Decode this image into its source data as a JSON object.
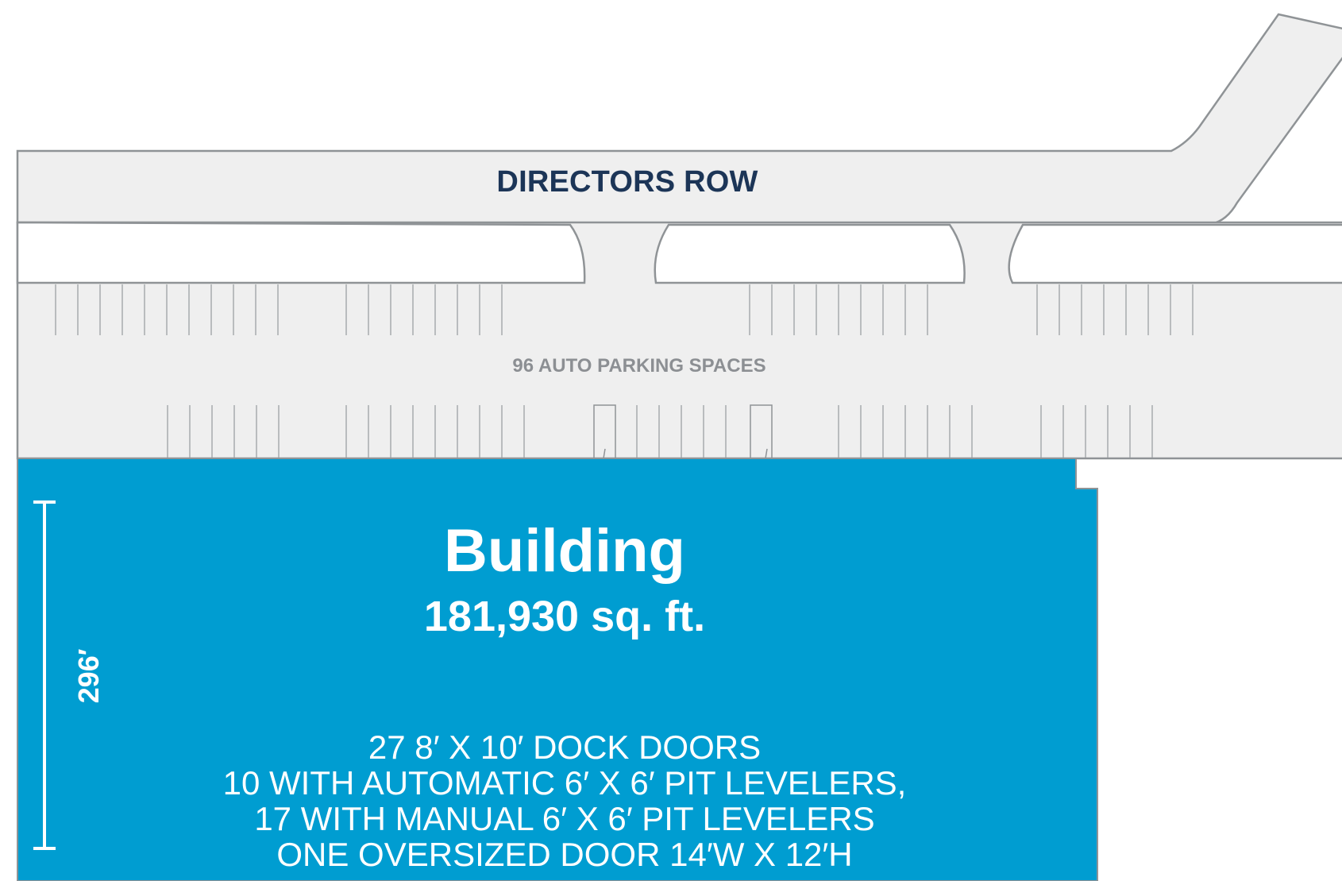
{
  "road": {
    "name": "DIRECTORS ROW"
  },
  "parking": {
    "label": "96 AUTO PARKING SPACES"
  },
  "building": {
    "title": "Building",
    "area": "181,930 sq. ft.",
    "notes": [
      "27  8′ X 10′ DOCK DOORS",
      "10 WITH AUTOMATIC 6′ X 6′ PIT LEVELERS,",
      "17 WITH MANUAL 6′ X 6′ PIT LEVELERS",
      "ONE OVERSIZED DOOR 14′W X 12′H"
    ],
    "depth_dimension": "296′"
  },
  "colors": {
    "paving": "#efefef",
    "outline": "#8f9396",
    "building": "#009dd1",
    "road_label": "#1c3557",
    "parking_label": "#8c8f93",
    "building_text": "#ffffff"
  }
}
